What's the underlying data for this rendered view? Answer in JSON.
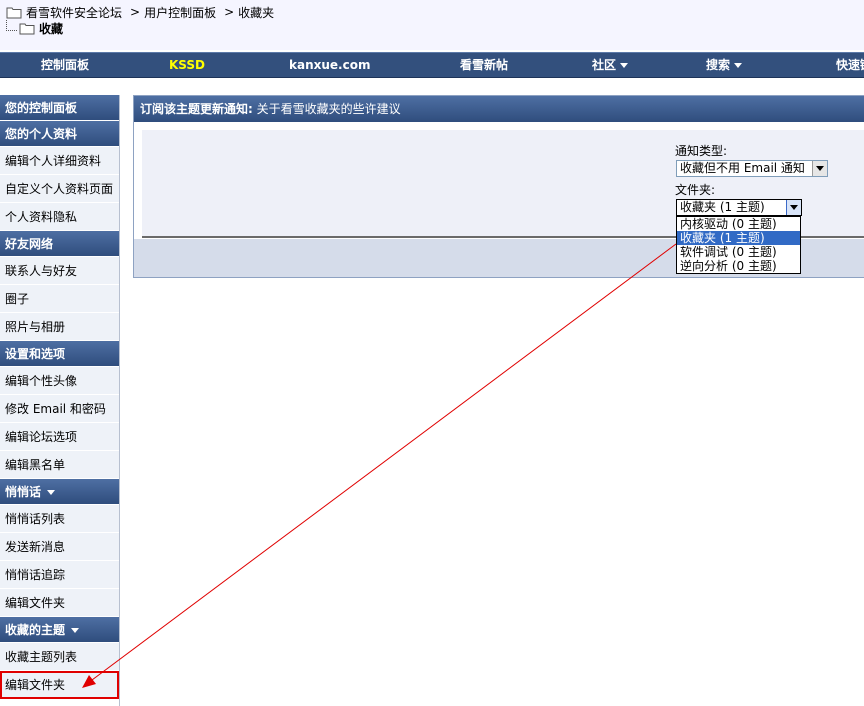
{
  "breadcrumb": {
    "items": [
      "看雪软件安全论坛",
      "用户控制面板",
      "收藏夹"
    ],
    "separator": ">",
    "current": "收藏"
  },
  "navbar": {
    "items": [
      {
        "label": "控制面板",
        "dropdown": false,
        "highlight": false
      },
      {
        "label": "KSSD",
        "dropdown": false,
        "highlight": true
      },
      {
        "label": "kanxue.com",
        "dropdown": false,
        "highlight": false
      },
      {
        "label": "看雪新帖",
        "dropdown": false,
        "highlight": false
      },
      {
        "label": "社区",
        "dropdown": true,
        "highlight": false
      },
      {
        "label": "搜索",
        "dropdown": true,
        "highlight": false
      },
      {
        "label": "快速链接",
        "dropdown": false,
        "highlight": false
      }
    ]
  },
  "sidebar": {
    "control_panel": "您的控制面板",
    "profile": {
      "title": "您的个人资料",
      "items": [
        "编辑个人详细资料",
        "自定义个人资料页面",
        "个人资料隐私"
      ]
    },
    "friends": {
      "title": "好友网络",
      "items": [
        "联系人与好友",
        "圈子",
        "照片与相册"
      ]
    },
    "settings": {
      "title": "设置和选项",
      "items": [
        "编辑个性头像",
        "修改 Email 和密码",
        "编辑论坛选项",
        "编辑黑名单"
      ]
    },
    "pm": {
      "title": "悄悄话",
      "items": [
        "悄悄话列表",
        "发送新消息",
        "悄悄话追踪",
        "编辑文件夹"
      ]
    },
    "subscriptions": {
      "title": "收藏的主题",
      "items": [
        "收藏主题列表",
        "编辑文件夹"
      ]
    }
  },
  "panel": {
    "title_lead": "订阅该主题更新通知:",
    "title_rest": "关于看雪收藏夹的些许建议",
    "notify_label": "通知类型:",
    "notify_value": "收藏但不用 Email 通知",
    "folder_label": "文件夹:",
    "folder_value": "收藏夹 (1 主题)",
    "folder_options": [
      "内核驱动 (0 主题)",
      "收藏夹 (1 主题)",
      "软件调试 (0 主题)",
      "逆向分析 (0 主题)"
    ],
    "folder_selected_index": 1
  },
  "colors": {
    "nav_bg": "#33507d",
    "highlight": "#ffff00",
    "annotation": "#e00000",
    "option_selected": "#316ac5"
  }
}
